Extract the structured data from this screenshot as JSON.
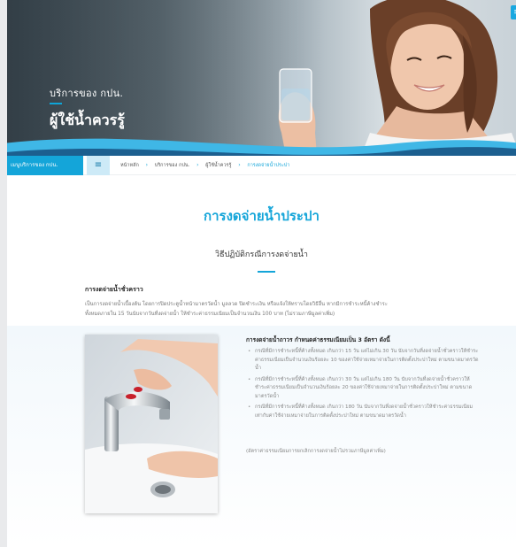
{
  "hero": {
    "subtitle": "บริการของ กปน.",
    "title": "ผู้ใช้น้ำควรรู้"
  },
  "corner_button": "≡",
  "navbar": {
    "menu_label": "เมนูบริการของ กปน.",
    "menu_icon": "≡"
  },
  "breadcrumb": [
    {
      "label": "หน้าหลัก"
    },
    {
      "label": "บริการของ กปน."
    },
    {
      "label": "ผู้ใช้น้ำควรรู้"
    },
    {
      "label": "การงดจ่ายน้ำประปา"
    }
  ],
  "breadcrumb_sep": "›",
  "main": {
    "title": "การงดจ่ายน้ำประปา",
    "subtitle": "วิธีปฏิบัติกรณีการงดจ่ายน้ำ"
  },
  "temporary": {
    "title": "การงดจ่ายน้ำชั่วคราว",
    "lines": [
      "เป็นการงดจ่ายน้ำเบื้องต้น โดยการปิดประตูน้ำหน้ามาตรวัดน้ำ มูลลวด ปิดซำระเงิน หรือแจ้งให้ทราบโดยวิธีอื่น หากมีการชำระหนี้ค้างชำระ",
      "ทั้งหมดภายใน 15 วันนับจากวันที่งดจ่ายน้ำ ให้ชำระค่าธรรมเนียมเป็นจำนวนเงิน 100 บาท (ไม่รวมภาษีมูลค่าเพิ่ม)"
    ]
  },
  "permanent": {
    "title": "การงดจ่ายน้ำถาวร กำหนดค่าธรรมเนียมเป็น 3 อัตรา ดังนี้",
    "items": [
      "กรณีที่มีการชำระหนี้ที่ค้างทั้งหมด เกินกว่า 15 วัน แต่ไม่เกิน 30 วัน นับจากวันที่งดจ่ายน้ำชั่วคราวให้ชำระค่าธรรมเนียมเป็นจำนวนเงินร้อยละ 10 ของค่าใช้จ่ายเหมาจ่ายในการติดตั้งประปาใหม่ ตามขนาดมาตรวัดน้ำ",
      "กรณีที่มีการชำระหนี้ที่ค้างทั้งหมด เกินกว่า 30 วัน แต่ไม่เกิน 180 วัน นับจากวันที่งดจ่ายน้ำชั่วคราวให้ชำระค่าธรรมเนียมเป็นจำนวนเงินร้อยละ 20 ของค่าใช้จ่ายเหมาจ่ายในการติดตั้งประปาใหม่ ตามขนาดมาตรวัดน้ำ",
      "กรณีที่มีการชำระหนี้ที่ค้างทั้งหมด เกินกว่า 180 วัน นับจากวันที่งดจ่ายน้ำชั่วคราวให้ชำระค่าธรรมเนียมเท่ากับค่าใช้จ่ายเหมาจ่ายในการติดตั้งประปาใหม่ ตามขนาดมาตรวัดน้ำ"
    ],
    "note": "(อัตราค่าธรรมเนียมการยกเลิกการงดจ่ายน้ำไม่รวมภาษีมูลค่าเพิ่ม)"
  },
  "colors": {
    "accent": "#14a5d9",
    "hero_wave_dark": "#1c5f8f",
    "hero_wave_light": "#3fb7e6"
  }
}
